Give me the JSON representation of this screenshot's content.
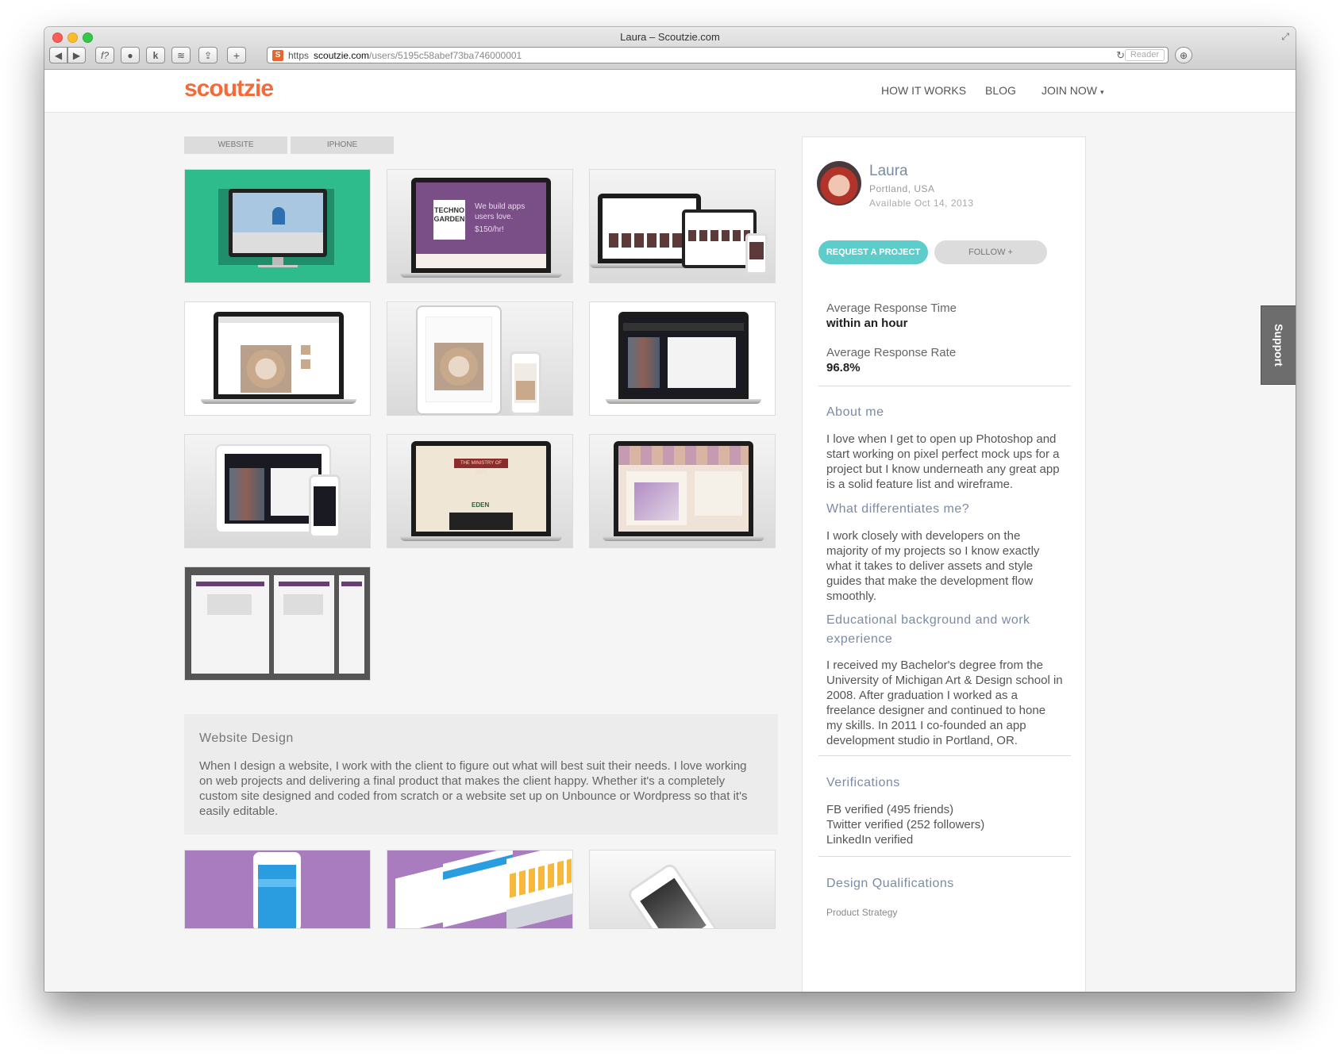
{
  "browser": {
    "title": "Laura – Scoutzie.com",
    "scheme": "https",
    "domain": "scoutzie.com",
    "path": "/users/5195c58abef73ba746000001",
    "reader_label": "Reader",
    "favicon_letter": "S",
    "toolbar_glyphs": {
      "back": "◀",
      "forward": "▶",
      "script": "f?",
      "record": "●",
      "k": "k",
      "layers": "≋",
      "share": "⇪",
      "add": "+",
      "reload": "↻",
      "download": "⊕",
      "fullscreen": "⤢"
    }
  },
  "site": {
    "logo": "scoutzie",
    "nav": {
      "how": "HOW IT WORKS",
      "blog": "BLOG",
      "join": "JOIN NOW",
      "join_caret": "▾"
    }
  },
  "portfolio": {
    "tabs": [
      "WEBSITE",
      "IPHONE"
    ],
    "thumb_texts": {
      "techno": "TECHNO GARDEN",
      "techno_tagline": "We build apps users love.",
      "techno_price": "$150/hr!",
      "ministry": "THE MINISTRY OF APPS",
      "eden": "EDEN"
    },
    "section": {
      "title": "Website Design",
      "body": "When I design a website, I work with the client to figure out what will best suit their needs. I love working on web projects and delivering a final product that makes the client happy. Whether it's a completely custom site designed and coded from scratch or a website set up on Unbounce or Wordpress so that it's easily editable."
    }
  },
  "profile": {
    "name": "Laura",
    "location": "Portland, USA",
    "available": "Available Oct 14, 2013",
    "request_label": "REQUEST A PROJECT",
    "follow_label": "FOLLOW +",
    "response_time_label": "Average Response Time",
    "response_time_value": "within an hour",
    "response_rate_label": "Average Response Rate",
    "response_rate_value": "96.8%",
    "about_title": "About me",
    "about_body": "I love when I get to open up Photoshop and start working on pixel perfect mock ups for a project but I know underneath any great app is a solid feature list and wireframe.",
    "diff_title": "What differentiates me?",
    "diff_body": "I work closely with developers on the majority of my projects so I know exactly what it takes to deliver assets and style guides that make the development flow smoothly.",
    "edu_title": "Educational background and work experience",
    "edu_body": "I received my Bachelor's degree from the University of Michigan Art & Design school in 2008. After graduation I worked as a freelance designer and continued to hone my skills. In 2011 I co-founded an app development studio in Portland, OR.",
    "verif_title": "Verifications",
    "verif_items": [
      "FB verified (495 friends)",
      "Twitter verified (252 followers)",
      "LinkedIn verified"
    ],
    "qual_title": "Design Qualifications",
    "qual_first": "Product Strategy"
  },
  "support_label": "Support",
  "colors": {
    "brand": "#f26b3a",
    "accent": "#5dcdcc",
    "link": "#7b8ba5"
  }
}
